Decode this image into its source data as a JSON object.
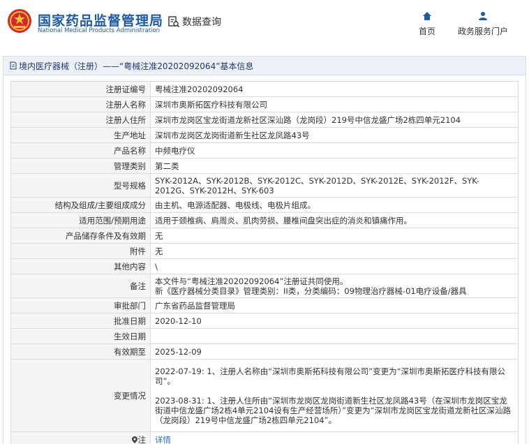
{
  "header": {
    "brand_cn": "国家药品监督管理局",
    "brand_en": "National Medical Products Administration",
    "data_query": "数据查询",
    "nav_home": "首页",
    "nav_service": "政务服务门户"
  },
  "breadcrumb": "境内医疗器械（注册）——“粤械注准20202092064”基本信息",
  "rows": [
    {
      "label": "注册证编号",
      "value": "粤械注准20202092064"
    },
    {
      "label": "注册人名称",
      "value": "深圳市奥斯拓医疗科技有限公司"
    },
    {
      "label": "注册人住所",
      "value": "深圳市龙岗区宝龙街道龙新社区深汕路（龙岗段）219号中信龙盛广场2栋四单元2104"
    },
    {
      "label": "生产地址",
      "value": "深圳市龙岗区龙岗街道新生社区龙凤路43号"
    },
    {
      "label": "产品名称",
      "value": "中频电疗仪"
    },
    {
      "label": "管理类别",
      "value": "第二类"
    },
    {
      "label": "型号规格",
      "value": "SYK-2012A、SYK-2012B、SYK-2012C、SYK-2012D、SYK-2012E、SYK-2012F、SYK-2012G、SYK-2012H、SYK-603"
    },
    {
      "label": "结构及组成/主要组成成分",
      "value": "由主机、电源适配器、电极线、电极片组成。"
    },
    {
      "label": "适用范围/预期用途",
      "value": "适用于颈椎病、肩周炎、肌肉劳损、腰椎间盘突出症的消炎和镇痛作用。"
    },
    {
      "label": "产品储存条件及有效期",
      "value": "无"
    },
    {
      "label": "附件",
      "value": "无"
    },
    {
      "label": "其他内容",
      "value": "\\"
    },
    {
      "label": "备注",
      "value_line1": "本文件与“粤械注准20202092064”注册证共同使用。",
      "value_line2": "新《医疗器械分类目录》管理类别：II类，分类编码：09物理治疗器械-01电疗设备/器具"
    },
    {
      "label": "审批部门",
      "value": "广东省药品监督管理局"
    },
    {
      "label": "批准日期",
      "value": "2020-12-10"
    },
    {
      "label": "生效日期",
      "value": ""
    },
    {
      "label": "有效期至",
      "value": "2025-12-09"
    },
    {
      "label": "变更情况",
      "change1": "2022-07-19: 1、注册人名称由“深圳市奥斯拓科技有限公司”变更为“深圳市奥斯拓医疗科技有限公司”。",
      "change2": "2023-08-31: 1、注册人住所由“深圳市龙岗区龙岗街道新生社区龙凤路43号（在深圳市龙岗区宝龙街道中信龙盛广场2栋4单元2104设有生产经营场所）”变更为“深圳市龙岗区宝龙街道龙新社区深汕路（龙岗段）219号中信龙盛广场2栋四单元2104”。"
    },
    {
      "label": "注",
      "value": "详情"
    }
  ],
  "colors": {
    "brand": "#1f5aa6",
    "link": "#2b6cc4",
    "label_bg": "#f5f5f5"
  }
}
